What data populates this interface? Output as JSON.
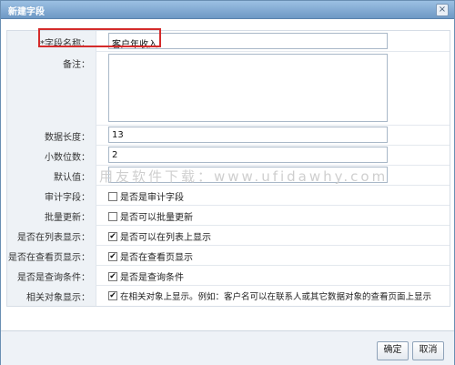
{
  "dialog": {
    "title": "新建字段"
  },
  "fields": {
    "field_name": {
      "label": "*字段名称：",
      "value": "客户年收入"
    },
    "remark": {
      "label": "备注：",
      "value": ""
    },
    "data_length": {
      "label": "数据长度：",
      "value": "13"
    },
    "decimal_places": {
      "label": "小数位数：",
      "value": "2"
    },
    "default_value": {
      "label": "默认值：",
      "value": ""
    },
    "audit": {
      "label": "审计字段：",
      "text": "是否是审计字段",
      "checked": false
    },
    "batch_update": {
      "label": "批量更新：",
      "text": "是否可以批量更新",
      "checked": false
    },
    "list_display": {
      "label": "是否在列表显示：",
      "text": "是否可以在列表上显示",
      "checked": true
    },
    "view_display": {
      "label": "是否在查看页显示：",
      "text": "是否在查看页显示",
      "checked": true
    },
    "query_condition": {
      "label": "是否是查询条件：",
      "text": "是否是查询条件",
      "checked": true
    },
    "related_display": {
      "label": "相关对象显示：",
      "text": "在相关对象上显示。例如：客户名可以在联系人或其它数据对象的查看页面上显示",
      "checked": true
    }
  },
  "watermark": "用友软件下载：www.ufidawhy.com",
  "buttons": {
    "ok": "确定",
    "cancel": "取消"
  },
  "colors": {
    "title_bar": "#7fa6cf",
    "highlight": "#d42b2b",
    "label_bg": "#eef2f6"
  }
}
